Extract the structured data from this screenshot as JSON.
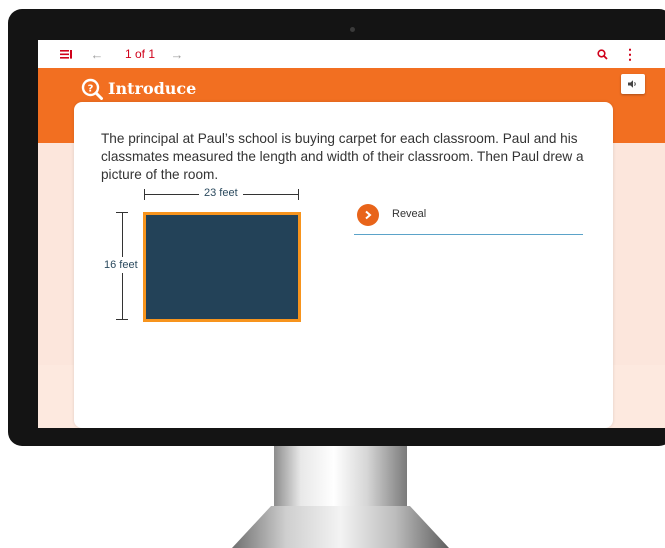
{
  "toolbar": {
    "menu_icon": "menu-icon",
    "back_icon": "arrow-left-icon",
    "page_counter": "1 of 1",
    "forward_icon": "arrow-right-icon",
    "search_icon": "search-icon",
    "more_icon": "more-vertical-icon"
  },
  "header": {
    "title": "Introduce",
    "icon": "magnifier-question-icon",
    "audio_icon": "speaker-icon"
  },
  "problem": {
    "text": "The principal at Paul’s school is buying carpet for each classroom. Paul and his classmates measured the length and width of their classroom. Then Paul drew a picture of the room."
  },
  "figure": {
    "width_label": "23 feet",
    "height_label": "16 feet",
    "room_color": "#234258",
    "border_color": "#f7941d"
  },
  "reveal": {
    "label": "Reveal",
    "icon": "chevron-right-icon"
  },
  "colors": {
    "accent": "#f26f21",
    "toolbar_icons": "#d0021b"
  }
}
